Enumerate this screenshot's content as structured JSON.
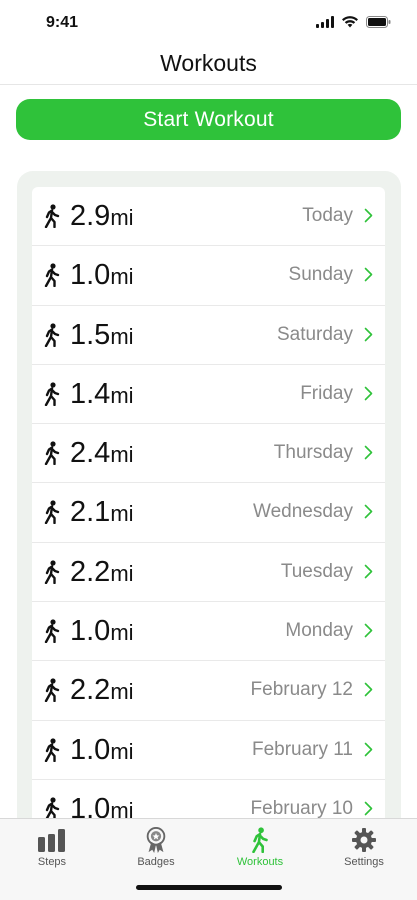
{
  "status_bar": {
    "time": "9:41"
  },
  "nav": {
    "title": "Workouts"
  },
  "start_button": {
    "label": "Start Workout"
  },
  "workouts": [
    {
      "distance": "2.9",
      "unit": "mi",
      "date": "Today"
    },
    {
      "distance": "1.0",
      "unit": "mi",
      "date": "Sunday"
    },
    {
      "distance": "1.5",
      "unit": "mi",
      "date": "Saturday"
    },
    {
      "distance": "1.4",
      "unit": "mi",
      "date": "Friday"
    },
    {
      "distance": "2.4",
      "unit": "mi",
      "date": "Thursday"
    },
    {
      "distance": "2.1",
      "unit": "mi",
      "date": "Wednesday"
    },
    {
      "distance": "2.2",
      "unit": "mi",
      "date": "Tuesday"
    },
    {
      "distance": "1.0",
      "unit": "mi",
      "date": "Monday"
    },
    {
      "distance": "2.2",
      "unit": "mi",
      "date": "February 12"
    },
    {
      "distance": "1.0",
      "unit": "mi",
      "date": "February 11"
    },
    {
      "distance": "1.0",
      "unit": "mi",
      "date": "February 10"
    }
  ],
  "tabs": [
    {
      "label": "Steps",
      "icon": "bar-chart-icon",
      "active": false
    },
    {
      "label": "Badges",
      "icon": "medal-icon",
      "active": false
    },
    {
      "label": "Workouts",
      "icon": "walking-icon",
      "active": true
    },
    {
      "label": "Settings",
      "icon": "gear-icon",
      "active": false
    }
  ],
  "colors": {
    "accent": "#2fc23a",
    "panel": "#eef2ee",
    "secondary_text": "#8a8a8a"
  }
}
